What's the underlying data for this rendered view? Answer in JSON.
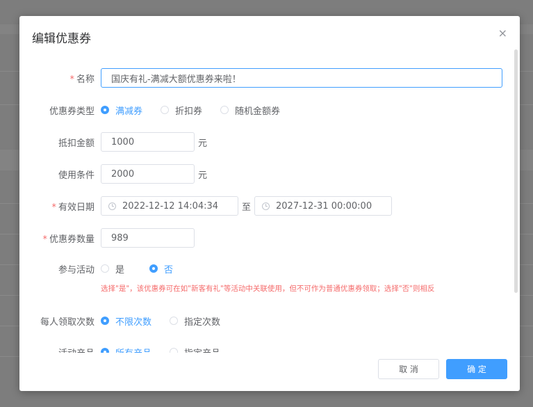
{
  "dialog": {
    "title": "编辑优惠券",
    "close_glyph": "×"
  },
  "form": {
    "name": {
      "label": "名称",
      "required_mark": "*",
      "value": "国庆有礼-满减大额优惠券来啦！"
    },
    "coupon_type": {
      "label": "优惠券类型",
      "options": [
        "满减券",
        "折扣券",
        "随机金额券"
      ],
      "selected": "满减券"
    },
    "discount_amount": {
      "label": "抵扣金额",
      "value": "1000",
      "unit": "元"
    },
    "usage_condition": {
      "label": "使用条件",
      "value": "2000",
      "unit": "元"
    },
    "valid_date": {
      "label": "有效日期",
      "required_mark": "*",
      "start": "2022-12-12 14:04:34",
      "separator": "至",
      "end": "2027-12-31 00:00:00"
    },
    "quantity": {
      "label": "优惠券数量",
      "required_mark": "*",
      "value": "989"
    },
    "join_activity": {
      "label": "参与活动",
      "options": [
        "是",
        "否"
      ],
      "selected": "否",
      "hint": "选择\"是\"，该优惠券可在如\"新客有礼\"等活动中关联使用，但不可作为普通优惠券领取；选择\"否\"则相反"
    },
    "claim_limit": {
      "label": "每人领取次数",
      "options": [
        "不限次数",
        "指定次数"
      ],
      "selected": "不限次数"
    },
    "products": {
      "label": "活动产品",
      "options": [
        "所有产品",
        "指定产品"
      ],
      "selected": "所有产品"
    }
  },
  "footer": {
    "cancel_label": "取 消",
    "confirm_label": "确 定"
  },
  "colors": {
    "primary": "#409eff",
    "danger": "#f56c6c",
    "text": "#606266"
  }
}
